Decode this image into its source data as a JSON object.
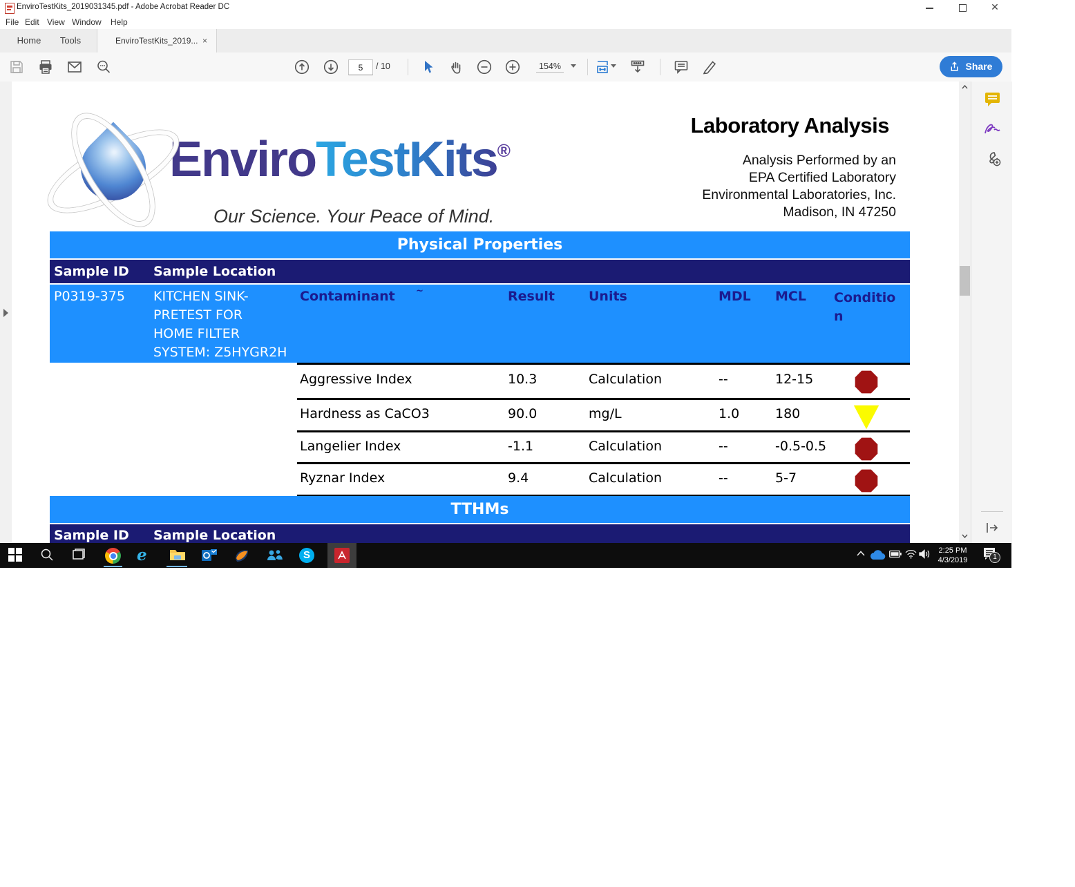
{
  "window": {
    "title": "EnviroTestKits_2019031345.pdf - Adobe Acrobat Reader DC"
  },
  "menu": {
    "items": [
      "File",
      "Edit",
      "View",
      "Window",
      "Help"
    ]
  },
  "tabs": {
    "home": "Home",
    "tools": "Tools",
    "document": "EnviroTestKits_2019...",
    "close": "×"
  },
  "toolbar": {
    "page_current": "5",
    "page_total": "/ 10",
    "zoom_level": "154%",
    "share_label": "Share"
  },
  "pdf": {
    "logo": {
      "brand_enviro": "Enviro",
      "brand_testkits": "TestKits",
      "registered": "®",
      "tagline": "Our Science. Your Peace of Mind."
    },
    "lab_header": {
      "title": "Laboratory Analysis",
      "lines": [
        "Analysis Performed by an",
        "EPA Certified Laboratory",
        "Environmental Laboratories, Inc.",
        "Madison, IN 47250"
      ]
    },
    "physical": {
      "section_title": "Physical Properties",
      "sample_id_header": "Sample ID",
      "sample_location_header": "Sample Location",
      "sample": {
        "id": "P0319-375",
        "location_lines": [
          "KITCHEN SINK-",
          "PRETEST FOR",
          "HOME FILTER",
          "SYSTEM: Z5HYGR2H"
        ]
      },
      "columns": {
        "contaminant": "Contaminant",
        "contaminant_mark": "~",
        "result": "Result",
        "units": "Units",
        "mdl": "MDL",
        "mcl": "MCL",
        "condition": "Condition"
      },
      "rows": [
        {
          "contaminant": "Aggressive Index",
          "result": "10.3",
          "units": "Calculation",
          "mdl": "--",
          "mcl": "12-15",
          "condition": "red-octagon"
        },
        {
          "contaminant": "Hardness as CaCO3",
          "result": "90.0",
          "units": "mg/L",
          "mdl": "1.0",
          "mcl": "180",
          "condition": "yellow-triangle"
        },
        {
          "contaminant": "Langelier Index",
          "result": "-1.1",
          "units": "Calculation",
          "mdl": "--",
          "mcl": "-0.5-0.5",
          "condition": "red-octagon"
        },
        {
          "contaminant": "Ryznar Index",
          "result": "9.4",
          "units": "Calculation",
          "mdl": "--",
          "mcl": "5-7",
          "condition": "red-octagon"
        }
      ]
    },
    "tthms": {
      "section_title": "TTHMs",
      "sample_id_header": "Sample ID",
      "sample_location_header": "Sample Location"
    }
  },
  "taskbar": {
    "clock_time": "2:25 PM",
    "clock_date": "4/3/2019",
    "notification_count": "1"
  },
  "colors": {
    "accent_blue": "#1E90FF",
    "navy": "#1b1b73",
    "stop_red": "#A01313",
    "warn_yellow": "#FBFB00",
    "share_blue": "#2F7CD6"
  }
}
